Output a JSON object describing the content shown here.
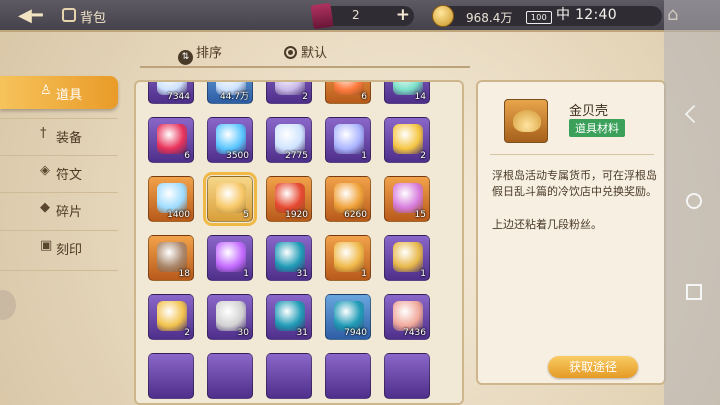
{
  "header": {
    "title": "背包",
    "crystal_count": "2",
    "coins": "968.4万"
  },
  "status_bar": {
    "battery": "100",
    "carrier": "中",
    "time": "12:40"
  },
  "sort": {
    "sort_label": "排序",
    "default_label": "默认"
  },
  "tabs": [
    {
      "label": "道具",
      "icon": "potion-icon",
      "active": true
    },
    {
      "label": "装备",
      "icon": "sword-icon",
      "active": false
    },
    {
      "label": "符文",
      "icon": "rune-icon",
      "active": false
    },
    {
      "label": "碎片",
      "icon": "shard-icon",
      "active": false
    },
    {
      "label": "刻印",
      "icon": "stamp-icon",
      "active": false
    }
  ],
  "items": [
    {
      "count": "7344",
      "quality": "purple",
      "icon": "crystal-icon"
    },
    {
      "count": "44.7万",
      "quality": "blue",
      "icon": "crystal-icon"
    },
    {
      "count": "2",
      "quality": "purple",
      "icon": "ring-icon"
    },
    {
      "count": "6",
      "quality": "orange",
      "icon": "orb-icon"
    },
    {
      "count": "14",
      "quality": "purple",
      "icon": "gem-icon"
    },
    {
      "count": "6",
      "quality": "purple",
      "icon": "red-gem-icon"
    },
    {
      "count": "3500",
      "quality": "purple",
      "icon": "cube-icon"
    },
    {
      "count": "2775",
      "quality": "purple",
      "icon": "crystal-icon"
    },
    {
      "count": "1",
      "quality": "purple",
      "icon": "card-icon"
    },
    {
      "count": "2",
      "quality": "purple",
      "icon": "flower-icon"
    },
    {
      "count": "1400",
      "quality": "orange",
      "icon": "pyramid-icon"
    },
    {
      "count": "5",
      "quality": "gold",
      "icon": "shell-icon",
      "selected": true
    },
    {
      "count": "1920",
      "quality": "orange",
      "icon": "ruby-icon"
    },
    {
      "count": "6260",
      "quality": "orange",
      "icon": "medal-icon"
    },
    {
      "count": "15",
      "quality": "orange",
      "icon": "ticket-icon"
    },
    {
      "count": "18",
      "quality": "orange",
      "icon": "robot-icon"
    },
    {
      "count": "1",
      "quality": "purple",
      "icon": "sphere-icon"
    },
    {
      "count": "31",
      "quality": "purple",
      "icon": "swirl-icon"
    },
    {
      "count": "1",
      "quality": "orange",
      "icon": "envelope-icon"
    },
    {
      "count": "1",
      "quality": "purple",
      "icon": "key-icon"
    },
    {
      "count": "2",
      "quality": "purple",
      "icon": "bracelet-icon"
    },
    {
      "count": "30",
      "quality": "purple",
      "icon": "tool-icon"
    },
    {
      "count": "31",
      "quality": "purple",
      "icon": "swirl-icon"
    },
    {
      "count": "7940",
      "quality": "blue",
      "icon": "swirl-icon"
    },
    {
      "count": "7436",
      "quality": "purple",
      "icon": "pig-icon"
    }
  ],
  "detail": {
    "name": "金贝壳",
    "badge": "道具材料",
    "description": "浮根岛活动专属货币，可在浮根岛假日乱斗篇的冷饮店中兑换奖励。",
    "extra": "上边还粘着几段粉丝。",
    "obtain_label": "获取途径"
  },
  "colors": {
    "accent": "#eba22e",
    "badge": "#3aa05a",
    "panel": "#f6efe2"
  }
}
